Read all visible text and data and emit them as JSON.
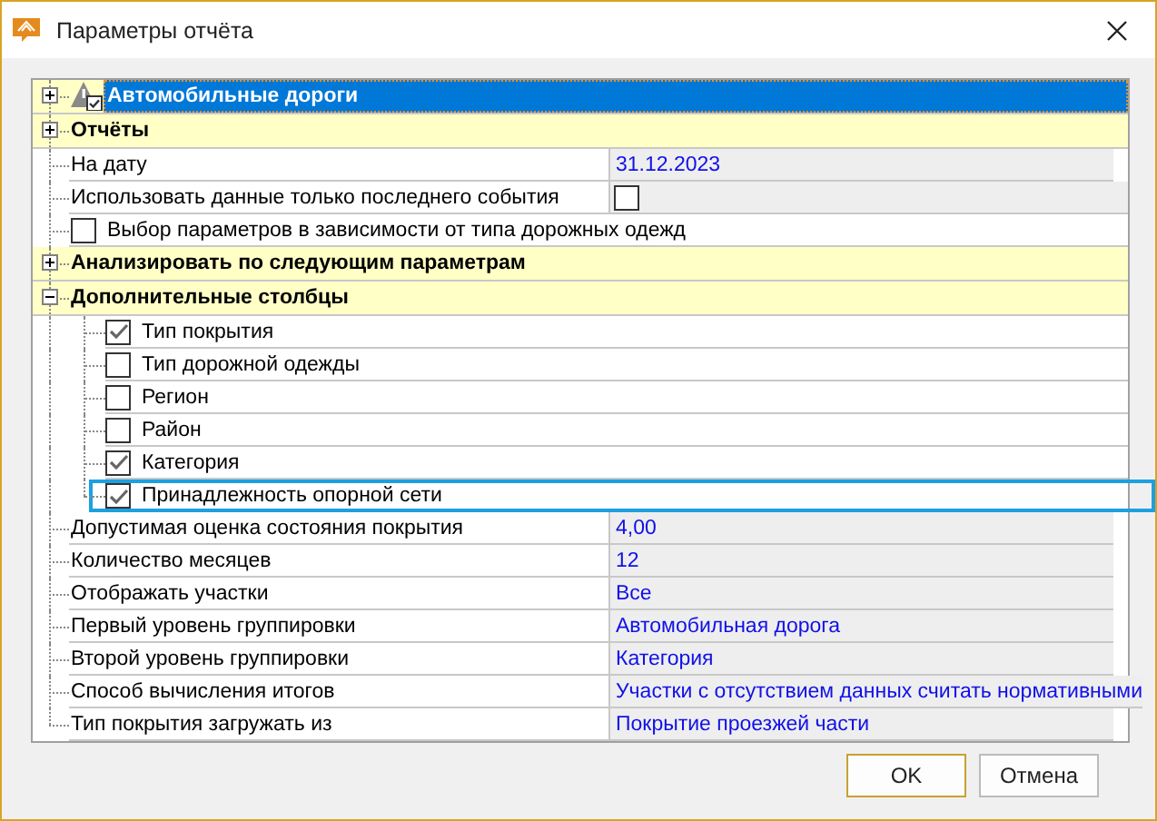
{
  "window": {
    "title": "Параметры отчёта"
  },
  "rows": [
    {
      "kind": "root",
      "label": "Автомобильные дороги",
      "expanded": false,
      "selected": true
    },
    {
      "kind": "category",
      "label": "Отчёты",
      "expanded": false
    },
    {
      "kind": "property",
      "label": "На дату",
      "value": "31.12.2023"
    },
    {
      "kind": "bool",
      "label": "Использовать данные только последнего события",
      "checked": false
    },
    {
      "kind": "check",
      "label": "Выбор параметров в зависимости от типа дорожных одежд",
      "checked": false
    },
    {
      "kind": "category",
      "label": "Анализировать по следующим параметрам",
      "expanded": false
    },
    {
      "kind": "category",
      "label": "Дополнительные столбцы",
      "expanded": true,
      "children": [
        {
          "label": "Тип покрытия",
          "checked": true,
          "focused": false
        },
        {
          "label": "Тип дорожной одежды",
          "checked": false,
          "focused": false
        },
        {
          "label": "Регион",
          "checked": false,
          "focused": false
        },
        {
          "label": "Район",
          "checked": false,
          "focused": false
        },
        {
          "label": "Категория",
          "checked": true,
          "focused": false
        },
        {
          "label": "Принадлежность опорной сети",
          "checked": true,
          "focused": true
        }
      ]
    },
    {
      "kind": "property",
      "label": "Допустимая оценка состояния покрытия",
      "value": "4,00"
    },
    {
      "kind": "property",
      "label": "Количество месяцев",
      "value": "12"
    },
    {
      "kind": "property",
      "label": "Отображать участки",
      "value": "Все"
    },
    {
      "kind": "property",
      "label": "Первый уровень группировки",
      "value": "Автомобильная дорога"
    },
    {
      "kind": "property",
      "label": "Второй уровень группировки",
      "value": "Категория"
    },
    {
      "kind": "property",
      "label": "Способ вычисления итогов",
      "value": "Участки с отсутствием данных считать нормативными"
    },
    {
      "kind": "property",
      "label": "Тип покрытия загружать из",
      "value": "Покрытие проезжей части"
    }
  ],
  "buttons": [
    {
      "label": "OK",
      "default": true
    },
    {
      "label": "Отмена",
      "default": false
    }
  ]
}
